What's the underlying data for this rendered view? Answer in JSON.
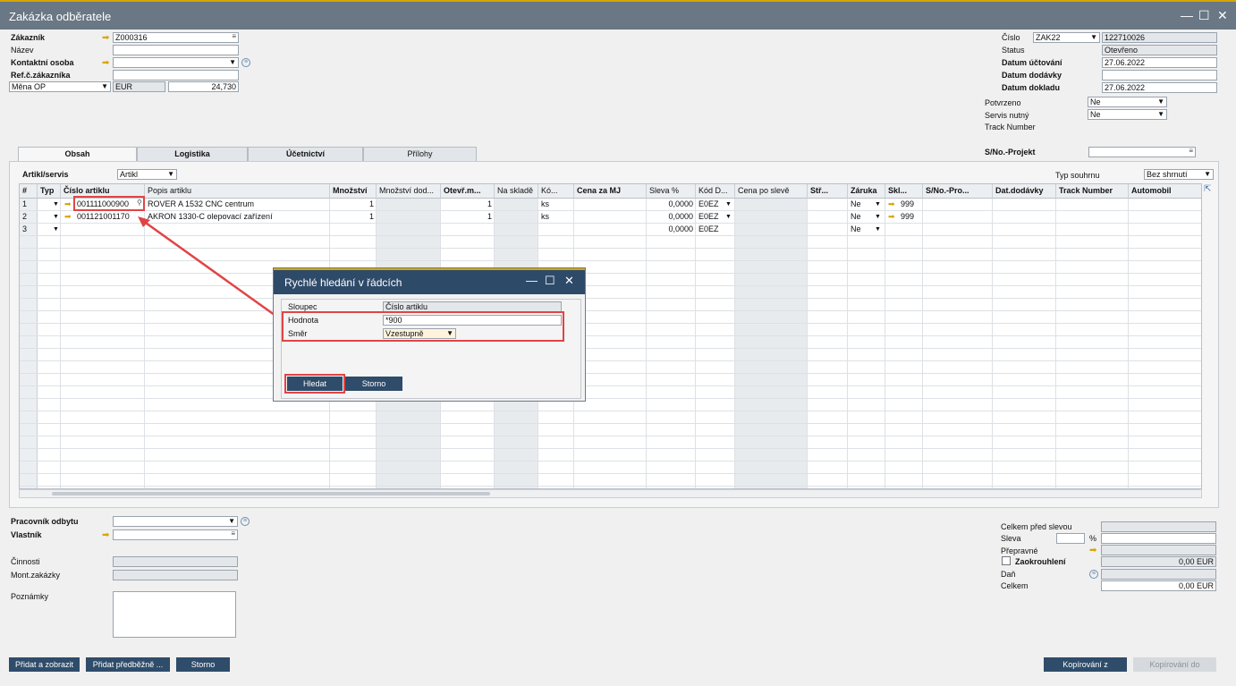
{
  "window": {
    "title": "Zakázka odběratele",
    "min": "—",
    "max": "☐",
    "close": "✕"
  },
  "header_left": {
    "customer_label": "Zákazník",
    "customer_value": "Z000316",
    "name_label": "Název",
    "contact_label": "Kontaktní osoba",
    "ref_label": "Ref.č.zákazníka",
    "currency_select": "Měna OP",
    "currency_code": "EUR",
    "currency_rate": "24,730"
  },
  "header_right": {
    "number_label": "Číslo",
    "series_value": "ZAK22",
    "number_value": "122710026",
    "status_label": "Status",
    "status_value": "Otevřeno",
    "posting_date_label": "Datum účtování",
    "posting_date_value": "27.06.2022",
    "delivery_date_label": "Datum dodávky",
    "document_date_label": "Datum dokladu",
    "document_date_value": "27.06.2022",
    "confirmed_label": "Potvrzeno",
    "confirmed_value": "Ne",
    "service_label": "Servis nutný",
    "service_value": "Ne",
    "track_label": "Track Number",
    "project_label": "S/No.-Projekt"
  },
  "tabs": [
    "Obsah",
    "Logistika",
    "Účetnictví",
    "Přílohy"
  ],
  "content": {
    "type_label": "Artikl/servis",
    "type_value": "Artikl",
    "summary_label": "Typ souhrnu",
    "summary_value": "Bez shrnutí"
  },
  "grid": {
    "columns": [
      "#",
      "Typ",
      "Číslo artiklu",
      "Popis artiklu",
      "Množství",
      "Množství dod...",
      "Otevř.m...",
      "Na skladě",
      "Kó...",
      "Cena za MJ",
      "Sleva %",
      "Kód D...",
      "Cena po slevě",
      "Stř...",
      "Záruka",
      "Skl...",
      "S/No.-Pro...",
      "Dat.dodávky",
      "Track Number",
      "Automobil"
    ],
    "rows": [
      {
        "no": "1",
        "item": "001111000900",
        "desc": "ROVER A 1532 CNC centrum",
        "qty": "1",
        "open": "1",
        "uom": "ks",
        "disc": "0,0000",
        "tax": "E0EZ",
        "warranty": "Ne",
        "wh": "999"
      },
      {
        "no": "2",
        "item": "001121001170",
        "desc": "AKRON 1330-C olepovací zařízení",
        "qty": "1",
        "open": "1",
        "uom": "ks",
        "disc": "0,0000",
        "tax": "E0EZ",
        "warranty": "Ne",
        "wh": "999"
      },
      {
        "no": "3",
        "item": "",
        "desc": "",
        "qty": "",
        "open": "",
        "uom": "",
        "disc": "0,0000",
        "tax": "E0EZ",
        "warranty": "Ne",
        "wh": ""
      }
    ]
  },
  "dialog": {
    "title": "Rychlé hledání v řádcích",
    "column_label": "Sloupec",
    "column_value": "Číslo artiklu",
    "value_label": "Hodnota",
    "value_value": "*900",
    "direction_label": "Směr",
    "direction_value": "Vzestupně",
    "search_button": "Hledat",
    "cancel_button": "Storno"
  },
  "footer_left": {
    "sales_employee_label": "Pracovník odbytu",
    "owner_label": "Vlastník",
    "activities_label": "Činnosti",
    "install_label": "Mont.zakázky",
    "notes_label": "Poznámky"
  },
  "footer_right": {
    "total_before_label": "Celkem před slevou",
    "discount_label": "Sleva",
    "percent": "%",
    "freight_label": "Přepravné",
    "rounding_label": "Zaokrouhlení",
    "rounding_value": "0,00 EUR",
    "tax_label": "Daň",
    "total_label": "Celkem",
    "total_value": "0,00 EUR"
  },
  "buttons": {
    "add_show": "Přidat a zobrazit",
    "add_draft": "Přidat předběžně ...",
    "cancel": "Storno",
    "copy_from": "Kopírování z",
    "copy_to": "Kopírování do"
  }
}
